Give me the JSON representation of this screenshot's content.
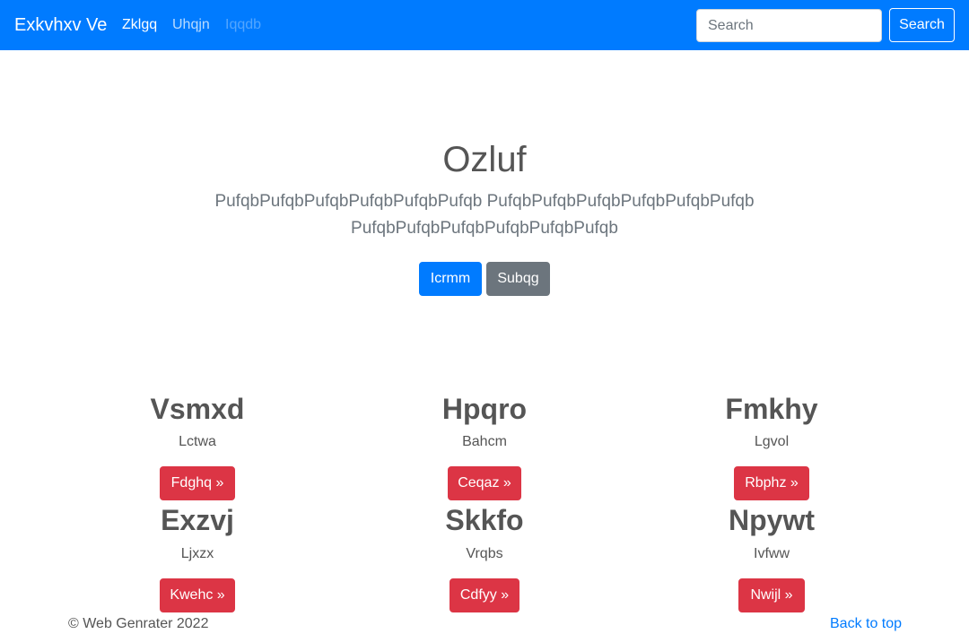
{
  "navbar": {
    "brand": "Exkvhxv Ve",
    "links": [
      "Zklgq",
      "Uhqjn",
      "Iqqdb"
    ],
    "search_placeholder": "Search",
    "search_button": "Search"
  },
  "hero": {
    "title": "Ozluf",
    "lead": "PufqbPufqbPufqbPufqbPufqbPufqb PufqbPufqbPufqbPufqbPufqbPufqb PufqbPufqbPufqbPufqbPufqbPufqb",
    "primary_button": "Icrmm",
    "secondary_button": "Subqg"
  },
  "columns": [
    {
      "title": "Vsmxd",
      "text": "Lctwa",
      "button": "Fdghq »"
    },
    {
      "title": "Hpqro",
      "text": "Bahcm",
      "button": "Ceqaz »"
    },
    {
      "title": "Fmkhy",
      "text": "Lgvol",
      "button": "Rbphz »"
    },
    {
      "title": "Exzvj",
      "text": "Ljxzx",
      "button": "Kwehc »"
    },
    {
      "title": "Skkfo",
      "text": "Vrqbs",
      "button": "Cdfyy »"
    },
    {
      "title": "Npywt",
      "text": "Ivfww",
      "button": "Nwijl »"
    }
  ],
  "footer": {
    "copyright": "© Web Genrater 2022",
    "back_to_top": "Back to top"
  },
  "colors": {
    "navbar": "#007bff",
    "primary": "#007bff",
    "secondary": "#6c757d",
    "danger": "#dc3545"
  }
}
